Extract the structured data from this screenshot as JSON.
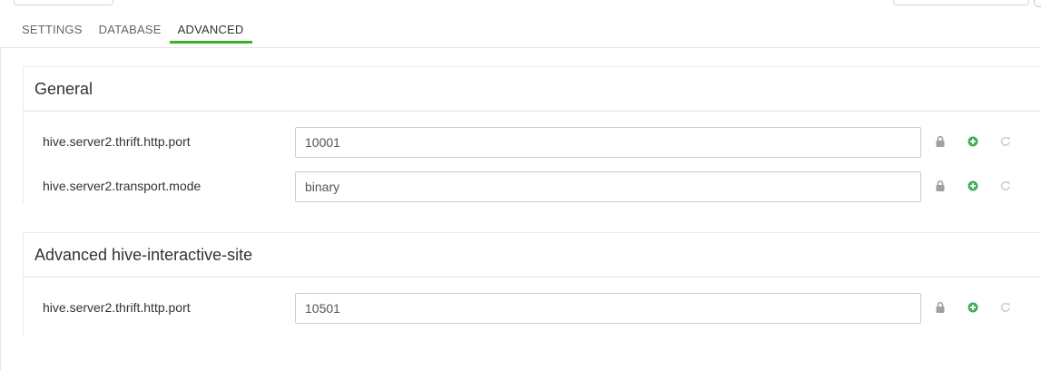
{
  "tabs": [
    {
      "label": "SETTINGS",
      "active": false
    },
    {
      "label": "DATABASE",
      "active": false
    },
    {
      "label": "ADVANCED",
      "active": true
    }
  ],
  "sections": [
    {
      "title": "General",
      "rows": [
        {
          "label": "hive.server2.thrift.http.port",
          "value": "10001"
        },
        {
          "label": "hive.server2.transport.mode",
          "value": "binary"
        }
      ]
    },
    {
      "title": "Advanced hive-interactive-site",
      "rows": [
        {
          "label": "hive.server2.thrift.http.port",
          "value": "10501"
        }
      ]
    }
  ],
  "icons": {
    "lock": "lock-icon",
    "add": "plus-circle-icon",
    "reset": "undo-icon"
  },
  "colors": {
    "accent": "#3fae2a",
    "add_icon": "#3fae5a",
    "lock_icon": "#a0a0a0",
    "reset_icon": "#cfcfcf"
  }
}
